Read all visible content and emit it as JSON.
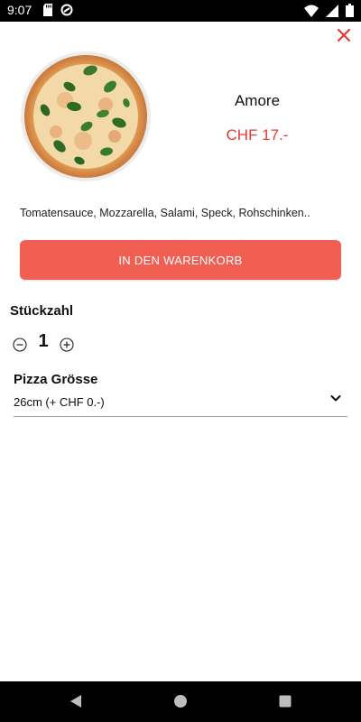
{
  "status_bar": {
    "time": "9:07",
    "icons_left": [
      "sd-card-icon",
      "circle-slash-icon"
    ],
    "icons_right": [
      "wifi-icon",
      "signal-icon",
      "battery-icon"
    ]
  },
  "close": {
    "icon": "close-icon",
    "color": "#e53935"
  },
  "product": {
    "name": "Amore",
    "price": "CHF 17.-",
    "description": "Tomatensauce, Mozzarella, Salami, Speck, Rohschinken..",
    "image": "pizza-image"
  },
  "actions": {
    "add_to_cart_label": "IN DEN WARENKORB",
    "button_color": "#f05f52"
  },
  "quantity": {
    "label": "Stückzahl",
    "value": "1"
  },
  "size": {
    "label": "Pizza Grösse",
    "selected": "26cm (+ CHF 0.-)"
  },
  "nav_bar": {
    "icons": [
      "back-icon",
      "home-icon",
      "recents-icon"
    ]
  }
}
